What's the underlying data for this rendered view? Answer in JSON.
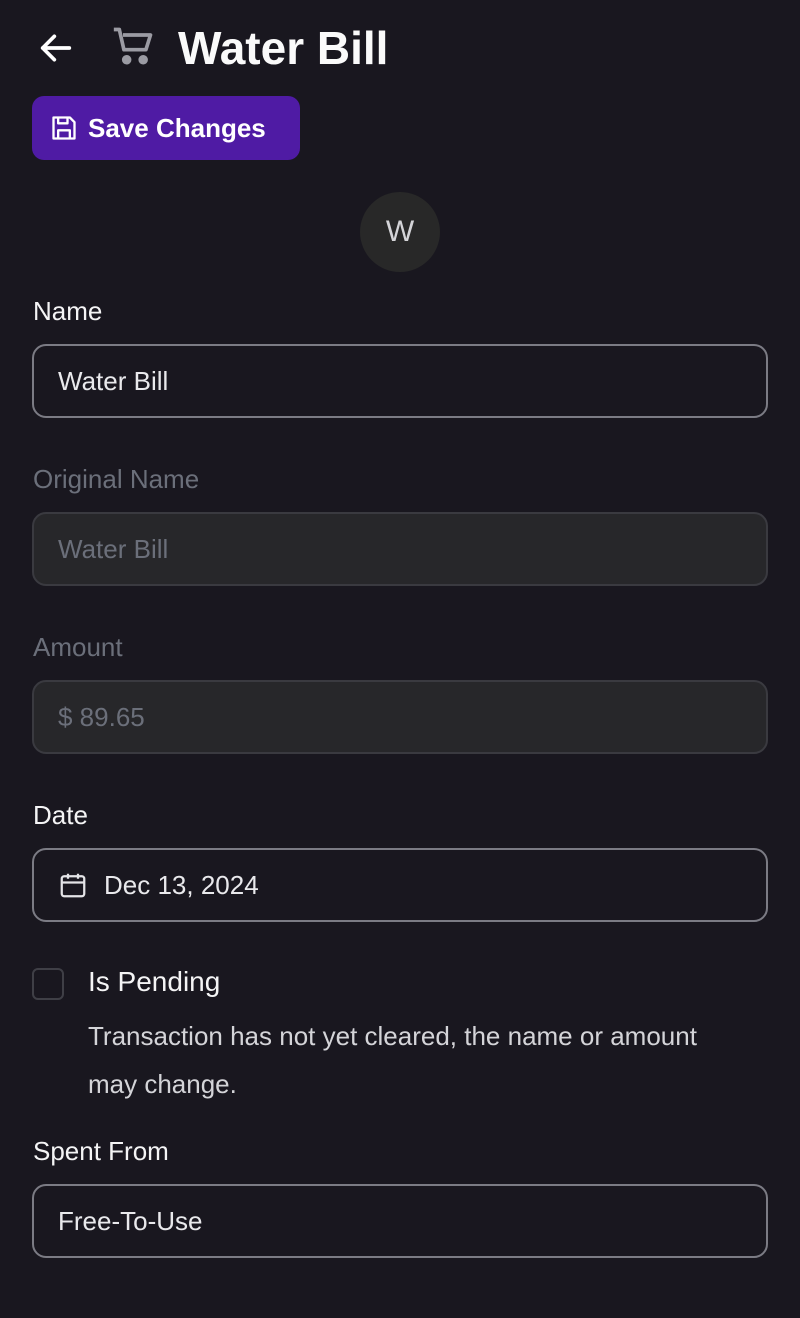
{
  "header": {
    "title": "Water Bill",
    "back_icon": "arrow-left-icon",
    "category_icon": "shopping-cart-icon"
  },
  "toolbar": {
    "save_label": "Save Changes",
    "save_icon": "floppy-disk-icon",
    "accent": "#4f1ba4"
  },
  "avatar": {
    "initial": "W"
  },
  "form": {
    "name": {
      "label": "Name",
      "value": "Water Bill"
    },
    "original_name": {
      "label": "Original Name",
      "value": "Water Bill"
    },
    "amount": {
      "label": "Amount",
      "value": "$ 89.65"
    },
    "date": {
      "label": "Date",
      "value": "Dec 13, 2024",
      "icon": "calendar-icon"
    },
    "pending": {
      "label": "Is Pending",
      "checked": false,
      "description": "Transaction has not yet cleared, the name or amount may change."
    },
    "spent_from": {
      "label": "Spent From",
      "value": "Free-To-Use"
    }
  }
}
